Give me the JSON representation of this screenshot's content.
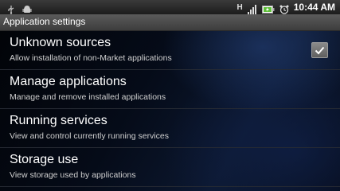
{
  "status_bar": {
    "time": "10:44 AM",
    "icons": [
      "usb-icon",
      "android-debug-icon",
      "hspa-icon",
      "signal-icon",
      "battery-icon",
      "alarm-icon"
    ],
    "hspa_label": "H"
  },
  "title_bar": {
    "title": "Application settings"
  },
  "settings": {
    "items": [
      {
        "title": "Unknown sources",
        "subtitle": "Allow installation of non-Market applications",
        "checked": true
      },
      {
        "title": "Manage applications",
        "subtitle": "Manage and remove installed applications"
      },
      {
        "title": "Running services",
        "subtitle": "View and control currently running services"
      },
      {
        "title": "Storage use",
        "subtitle": "View storage used by applications"
      }
    ]
  },
  "colors": {
    "background": "#000000",
    "divider": "#262a33",
    "text": "#ffffff",
    "subtext": "#d0d0d0"
  }
}
